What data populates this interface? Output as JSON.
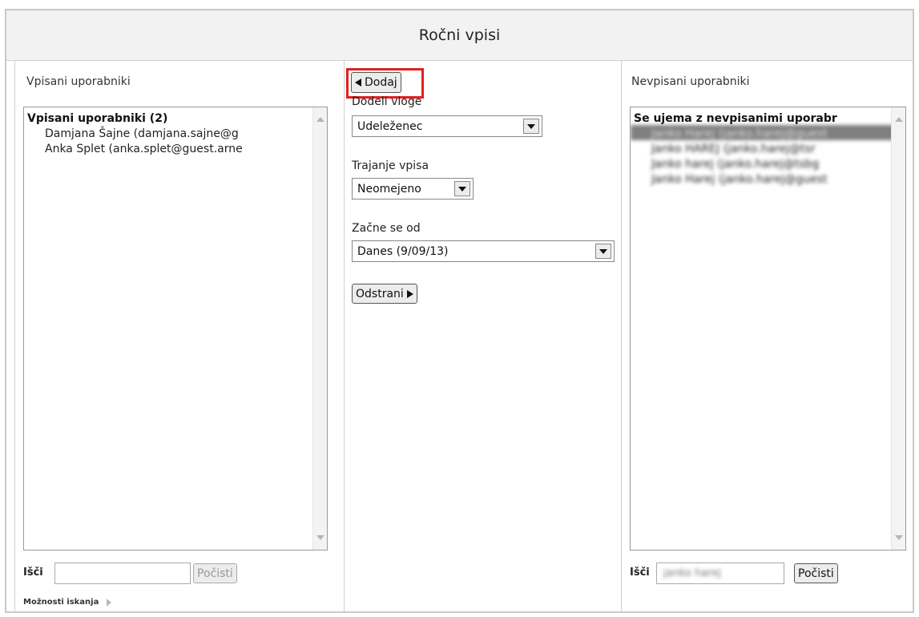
{
  "dialog": {
    "title": "Ročni vpisi"
  },
  "left": {
    "label": "Vpisani uporabniki",
    "list": {
      "group": "Vpisani uporabniki (2)",
      "items": [
        "Damjana Šajne (damjana.sajne@g",
        "Anka Splet (anka.splet@guest.arne"
      ]
    },
    "search": {
      "label": "Išči",
      "value": "",
      "clear_button": "Počisti"
    },
    "options_label": "Možnosti iskanja"
  },
  "middle": {
    "add_button": "Dodaj",
    "assign_roles": {
      "label": "Dodeli vloge",
      "value": "Udeleženec"
    },
    "duration": {
      "label": "Trajanje vpisa",
      "value": "Neomejeno"
    },
    "starts": {
      "label": "Začne se od",
      "value": "Danes (9/09/13)"
    },
    "remove_button": "Odstrani"
  },
  "right": {
    "label": "Nevpisani uporabniki",
    "list": {
      "group": "Se ujema z nevpisanimi uporabr",
      "items": [
        "Janko Harej (janko.harej@guest",
        "Janko HAREJ (janko.harej@tsr",
        "Janko harej (janko.harej@tsbg",
        "Janko Harej (janko.harej@guest"
      ]
    },
    "search": {
      "label": "Išči",
      "value": "janko harej",
      "clear_button": "Počisti"
    }
  },
  "colors": {
    "highlight": "#e02020",
    "selected_row": "#7f7f7f"
  }
}
